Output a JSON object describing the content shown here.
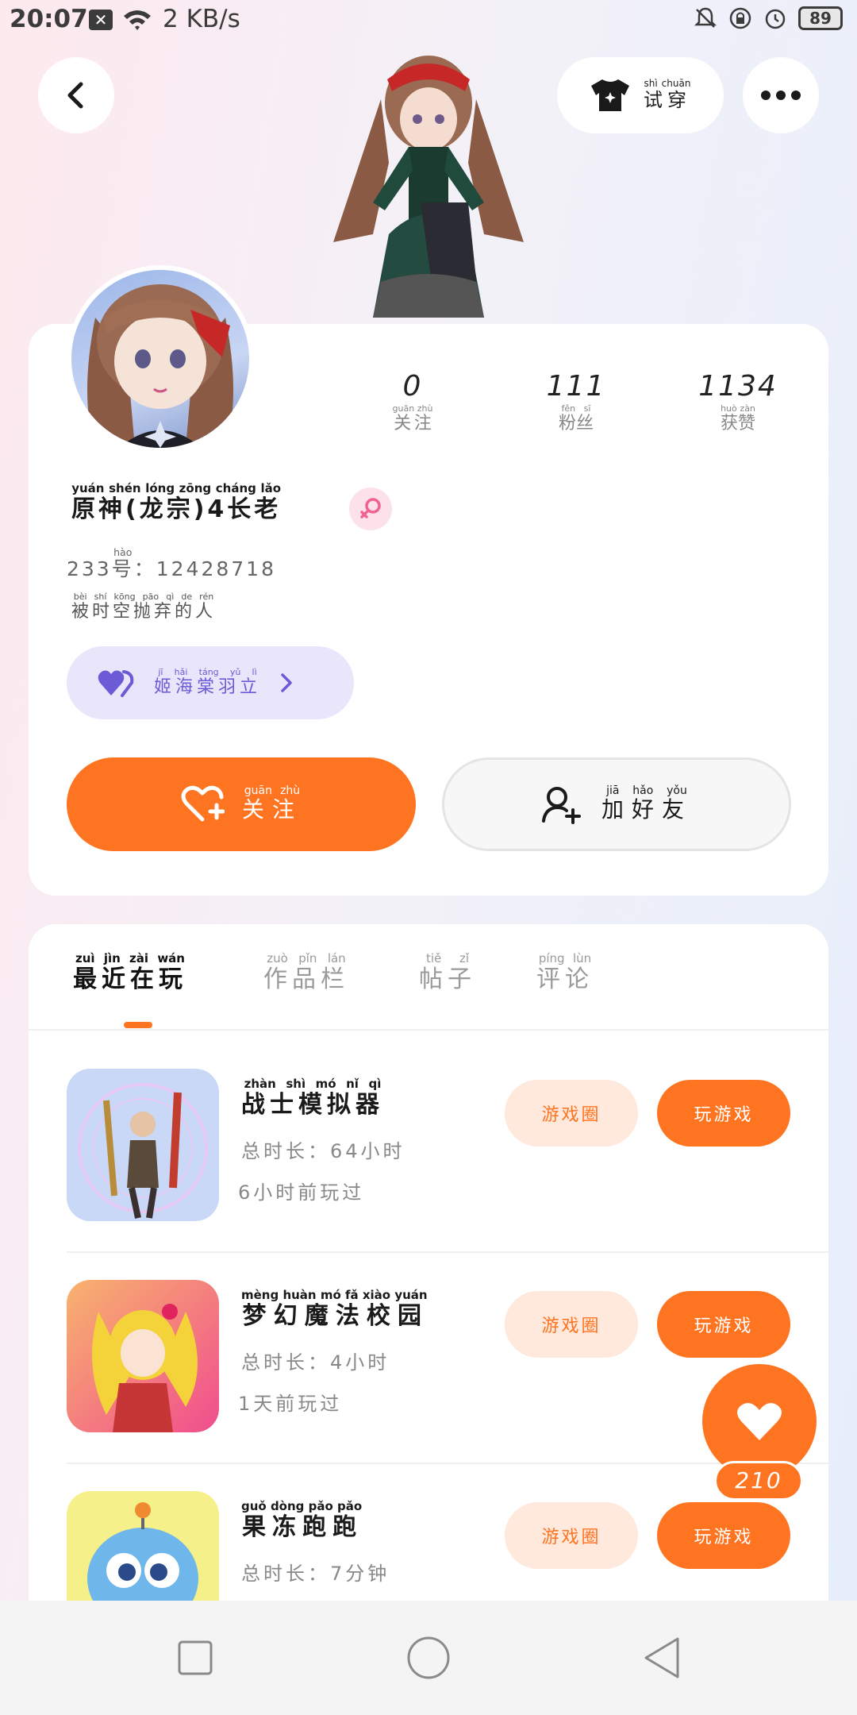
{
  "status_bar": {
    "time": "20:07",
    "net_speed": "2 KB/s",
    "battery": "89"
  },
  "header": {
    "try_on": {
      "ruby": "shì chuān",
      "label": "试穿"
    }
  },
  "profile": {
    "stats": [
      {
        "value": "0",
        "label": "关注",
        "ruby": "guān zhù"
      },
      {
        "value": "111",
        "label": "粉丝",
        "ruby": "fěn sī"
      },
      {
        "value": "1134",
        "label": "获赞",
        "ruby": "huò zàn"
      }
    ],
    "username": "原神(龙宗)4长老",
    "username_ruby": "yuán shén lóng zōng cháng lǎo",
    "uid_prefix": "233",
    "uid_hao": "号",
    "uid_hao_ruby": "hào",
    "uid_value": "：12428718",
    "bio": "被时空抛弃的人",
    "bio_ruby": "bèi shí kōng pāo qì de rén",
    "guild_name": "姬海棠羽立",
    "guild_ruby": "jī hǎi táng yǔ lì",
    "follow": {
      "label": "关注",
      "ruby": "guān zhù"
    },
    "add_friend": {
      "label": "加好友",
      "ruby": "jiā hǎo yǒu"
    }
  },
  "tabs": [
    {
      "label": "最近在玩",
      "ruby": "zuì jìn zài wán",
      "active": true
    },
    {
      "label": "作品栏",
      "ruby": "zuò pǐn lán",
      "active": false
    },
    {
      "label": "帖子",
      "ruby": "tiě zǐ",
      "active": false
    },
    {
      "label": "评论",
      "ruby": "píng lùn",
      "active": false
    }
  ],
  "games": [
    {
      "title": "战士模拟器",
      "title_ruby": "zhàn shì mó nǐ qì",
      "playtime": "总时长：64小时",
      "last_played": "6小时前玩过",
      "circle_label": "游戏圈",
      "play_label": "玩游戏"
    },
    {
      "title": "梦幻魔法校园",
      "title_ruby": "mèng huàn mó fǎ xiào yuán",
      "playtime": "总时长：4小时",
      "last_played": "1天前玩过",
      "circle_label": "游戏圈",
      "play_label": "玩游戏"
    },
    {
      "title": "果冻跑跑",
      "title_ruby": "guǒ dòng pǎo pǎo",
      "playtime": "总时长：7分钟",
      "last_played": "",
      "circle_label": "游戏圈",
      "play_label": "玩游戏"
    }
  ],
  "like_fab": {
    "count": "210"
  },
  "colors": {
    "accent": "#fe7420",
    "guild": "#6b5bd6",
    "gender_female": "#f06292"
  }
}
